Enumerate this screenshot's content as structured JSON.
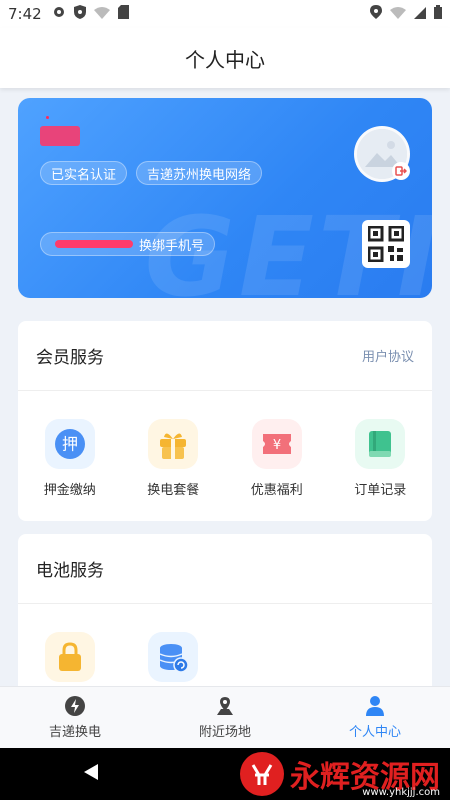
{
  "status_bar": {
    "time": "7:42"
  },
  "header": {
    "title": "个人中心"
  },
  "profile": {
    "verified_label": "已实名认证",
    "network_label": "吉递苏州换电网络",
    "change_phone_label": "换绑手机号",
    "watermark": "GETI"
  },
  "member_services": {
    "title": "会员服务",
    "link_label": "用户协议",
    "items": [
      {
        "label": "押金缴纳",
        "icon": "deposit-icon",
        "glyph": "押",
        "color": "#4a90f5",
        "bg": "#eaf4ff"
      },
      {
        "label": "换电套餐",
        "icon": "gift-icon",
        "color": "#f5b531",
        "bg": "#fff6e3"
      },
      {
        "label": "优惠福利",
        "icon": "coupon-icon",
        "glyph": "¥",
        "color": "#f2707a",
        "bg": "#ffefef"
      },
      {
        "label": "订单记录",
        "icon": "book-icon",
        "color": "#3fc28f",
        "bg": "#e8faf2"
      }
    ]
  },
  "battery_services": {
    "title": "电池服务",
    "items": [
      {
        "icon": "lock-icon",
        "color": "#f5b531",
        "bg": "#fff6e3"
      },
      {
        "icon": "database-refresh-icon",
        "color": "#4a90f5",
        "bg": "#eaf4ff"
      }
    ]
  },
  "tabbar": {
    "tabs": [
      {
        "label": "吉递换电",
        "icon": "lightning-icon"
      },
      {
        "label": "附近场地",
        "icon": "map-pin-icon"
      },
      {
        "label": "个人中心",
        "icon": "person-icon",
        "active": true
      }
    ]
  },
  "watermark_brand": {
    "main": "永辉资源网",
    "url": "www.yhkjjj.com"
  }
}
